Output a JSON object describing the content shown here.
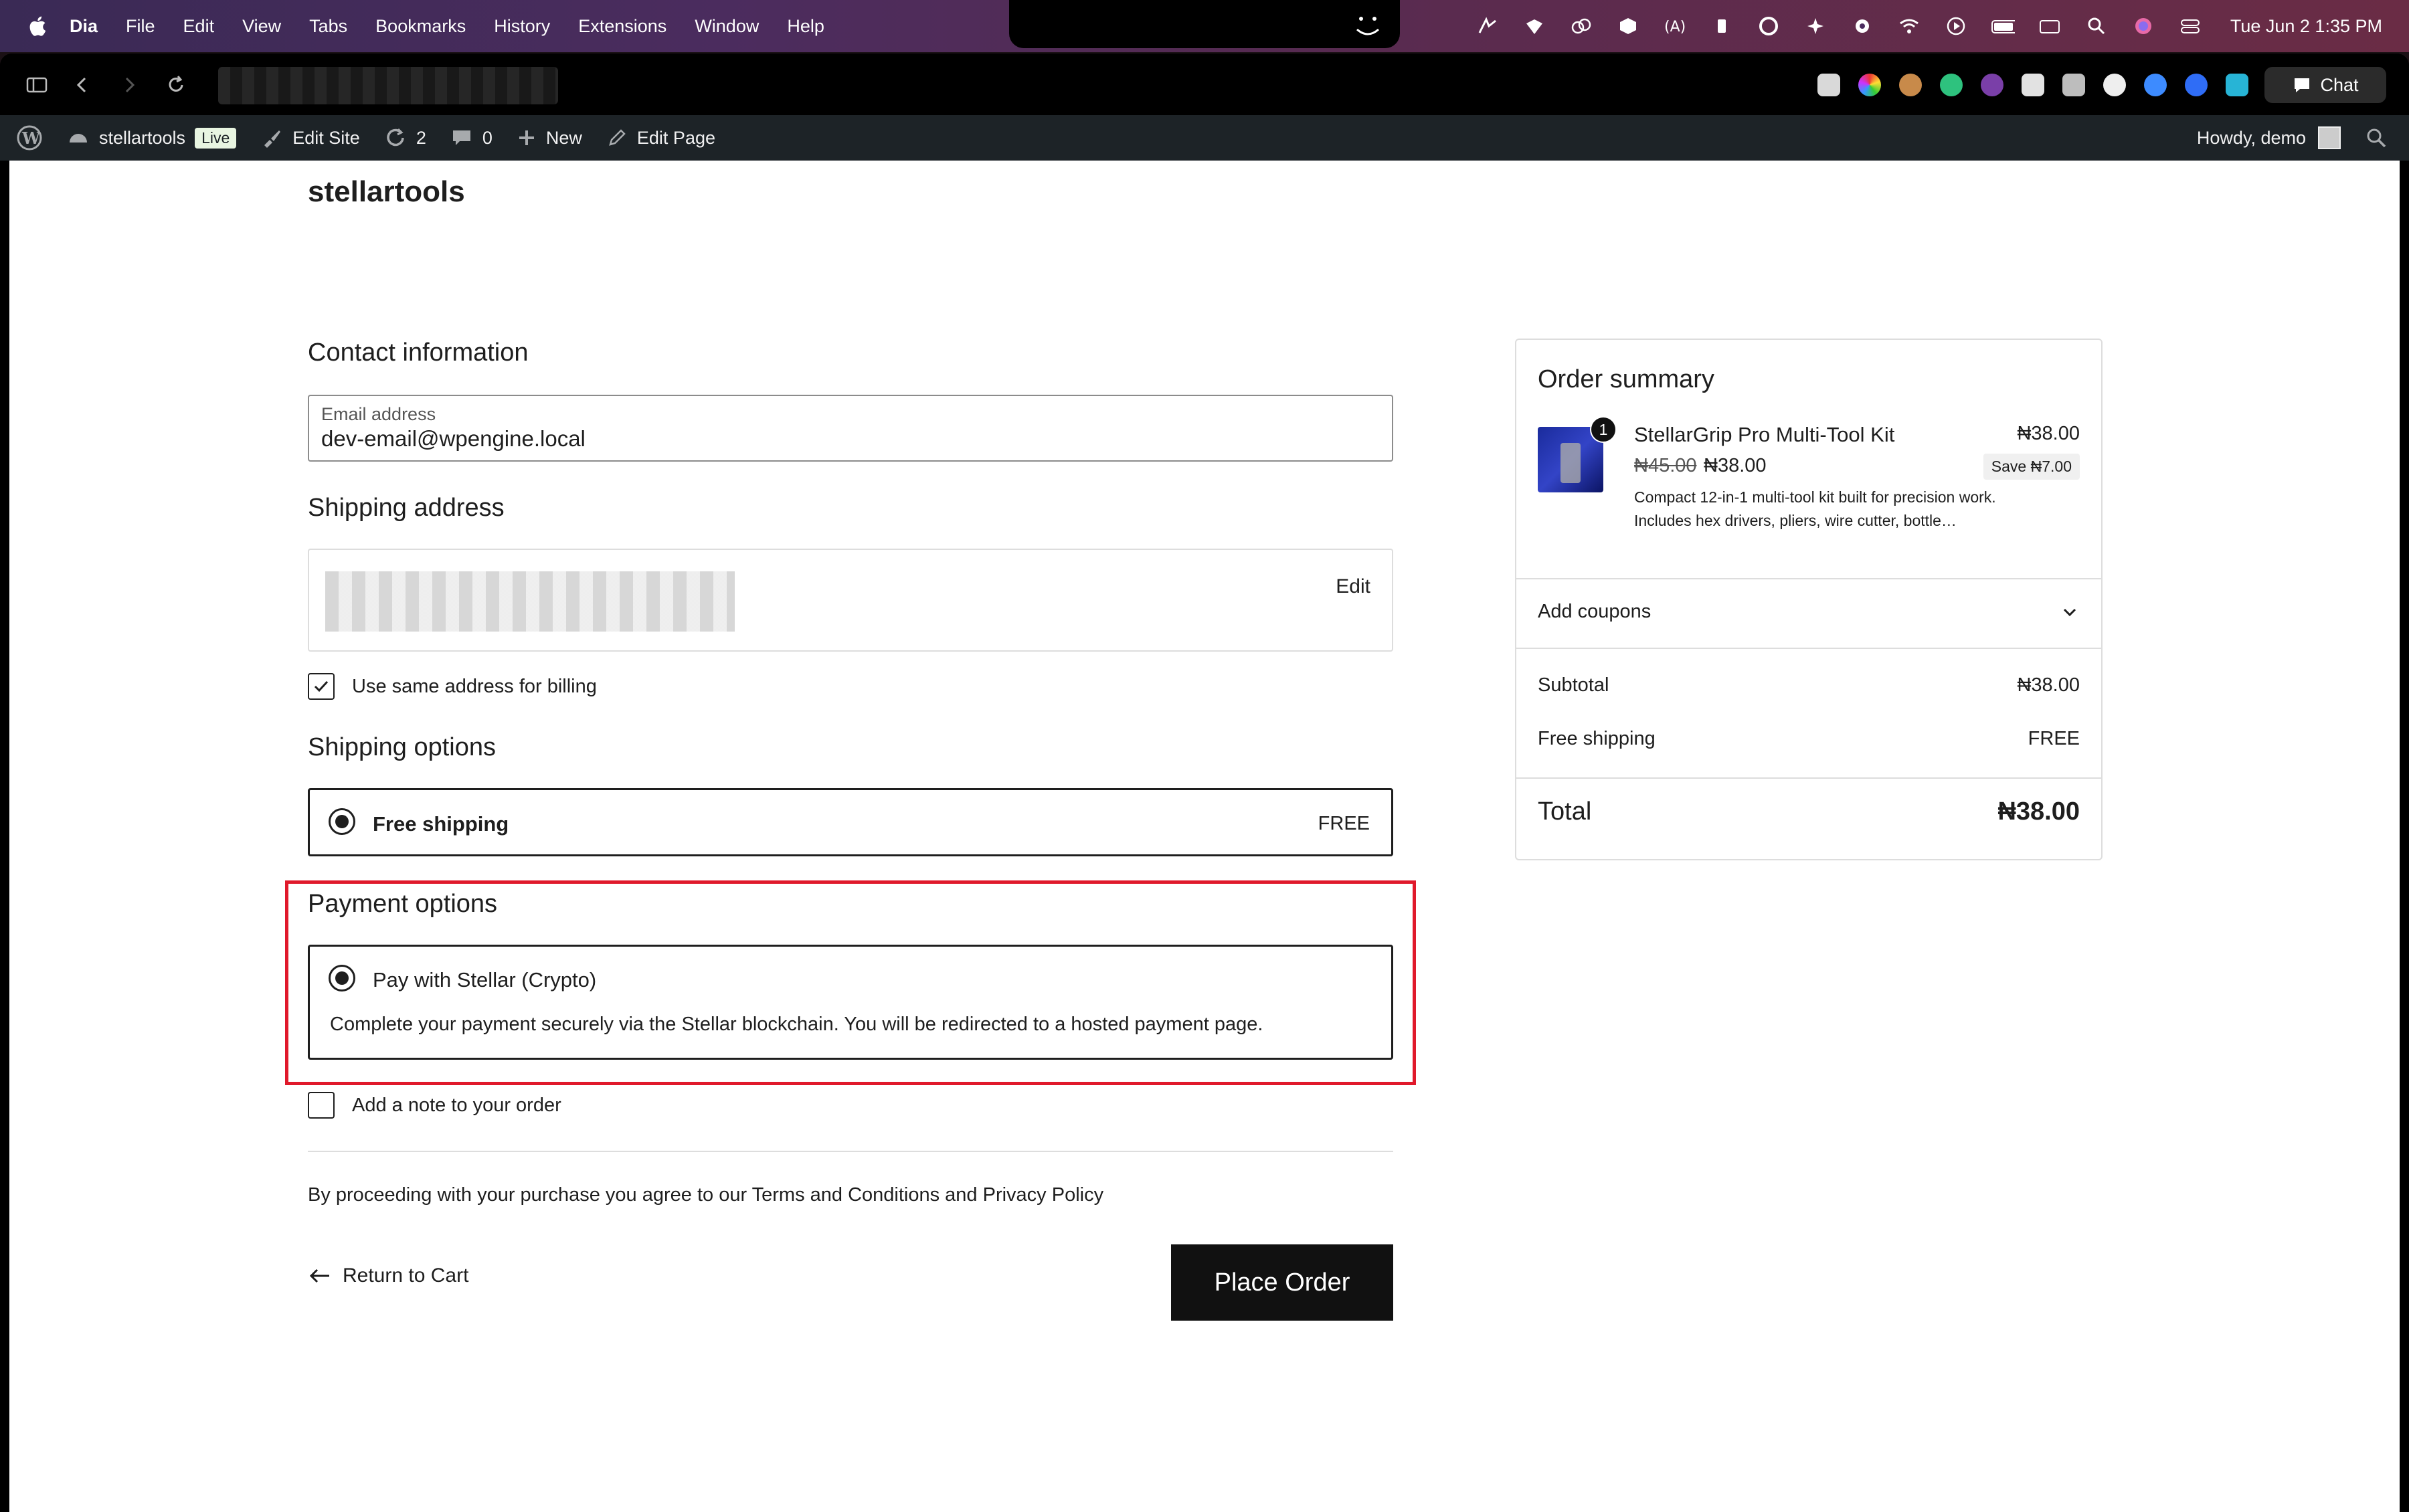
{
  "menubar": {
    "app_name": "Dia",
    "items": [
      "File",
      "Edit",
      "View",
      "Tabs",
      "Bookmarks",
      "History",
      "Extensions",
      "Window",
      "Help"
    ],
    "clock": "Tue Jun 2  1:35 PM"
  },
  "browser": {
    "chat_label": "Chat"
  },
  "adminbar": {
    "site_name": "stellartools",
    "live_label": "Live",
    "edit_site_label": "Edit Site",
    "updates_count": "2",
    "comments_count": "0",
    "new_label": "New",
    "edit_page_label": "Edit Page",
    "howdy": "Howdy, demo"
  },
  "page": {
    "site_title": "stellartools",
    "contact": {
      "title": "Contact information",
      "email_label": "Email address",
      "email_value": "dev-email@wpengine.local"
    },
    "shipping_address": {
      "title": "Shipping address",
      "edit_label": "Edit"
    },
    "billing_checkbox_label": "Use same address for billing",
    "shipping_options": {
      "title": "Shipping options",
      "option_label": "Free shipping",
      "option_price": "FREE"
    },
    "payment_options": {
      "title": "Payment options",
      "option_label": "Pay with Stellar (Crypto)",
      "description": "Complete your payment securely via the Stellar blockchain. You will be redirected to a hosted payment page."
    },
    "note_checkbox_label": "Add a note to your order",
    "terms_text": "By proceeding with your purchase you agree to our Terms and Conditions and Privacy Policy",
    "return_label": "Return to Cart",
    "place_order_label": "Place Order"
  },
  "summary": {
    "title": "Order summary",
    "product": {
      "qty": "1",
      "name": "StellarGrip Pro Multi-Tool Kit",
      "price": "₦38.00",
      "old_price": "₦45.00",
      "new_price": "₦38.00",
      "save": "Save ₦7.00",
      "description": "Compact 12-in-1 multi-tool kit built for precision work. Includes hex drivers, pliers, wire cutter, bottle…"
    },
    "coupons_label": "Add coupons",
    "subtotal_label": "Subtotal",
    "subtotal_value": "₦38.00",
    "shipping_label": "Free shipping",
    "shipping_value": "FREE",
    "total_label": "Total",
    "total_value": "₦38.00"
  },
  "colors": {
    "highlight": "#e0192b",
    "admin_bar": "#1d2327",
    "button": "#111111"
  }
}
